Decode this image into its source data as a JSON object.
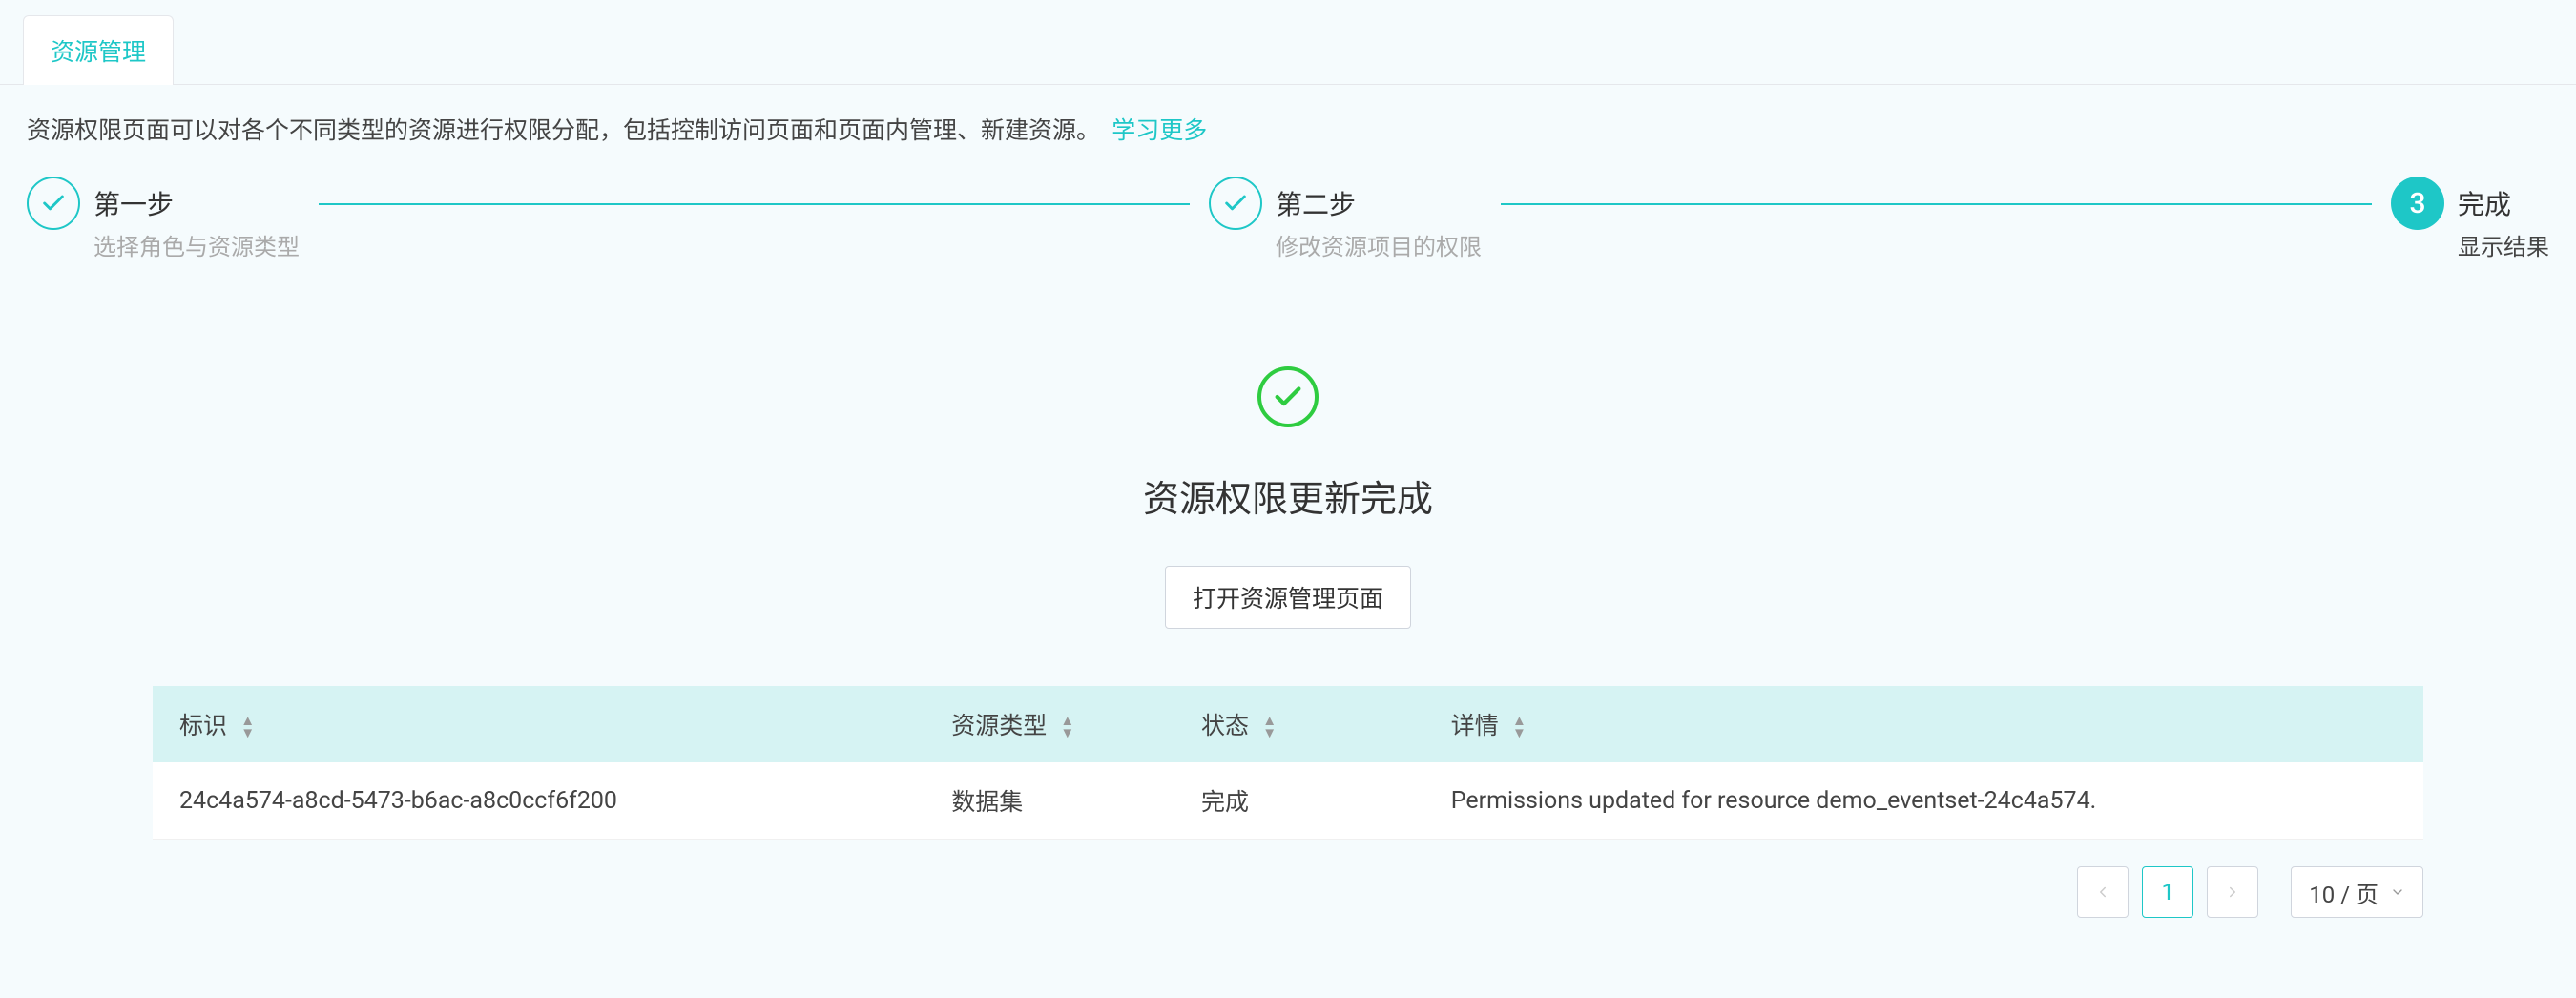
{
  "tabs": {
    "resource_management": "资源管理"
  },
  "description": {
    "text": "资源权限页面可以对各个不同类型的资源进行权限分配，包括控制访问页面和页面内管理、新建资源。",
    "link": "学习更多"
  },
  "steps": {
    "step1": {
      "title": "第一步",
      "subtitle": "选择角色与资源类型"
    },
    "step2": {
      "title": "第二步",
      "subtitle": "修改资源项目的权限"
    },
    "step3": {
      "number": "3",
      "title": "完成",
      "subtitle": "显示结果"
    }
  },
  "result": {
    "title": "资源权限更新完成",
    "button": "打开资源管理页面"
  },
  "table": {
    "headers": {
      "id": "标识",
      "type": "资源类型",
      "status": "状态",
      "detail": "详情"
    },
    "rows": [
      {
        "id": "24c4a574-a8cd-5473-b6ac-a8c0ccf6f200",
        "type": "数据集",
        "status": "完成",
        "detail": "Permissions updated for resource demo_eventset-24c4a574."
      }
    ]
  },
  "pagination": {
    "current": "1",
    "page_size": "10 / 页"
  }
}
